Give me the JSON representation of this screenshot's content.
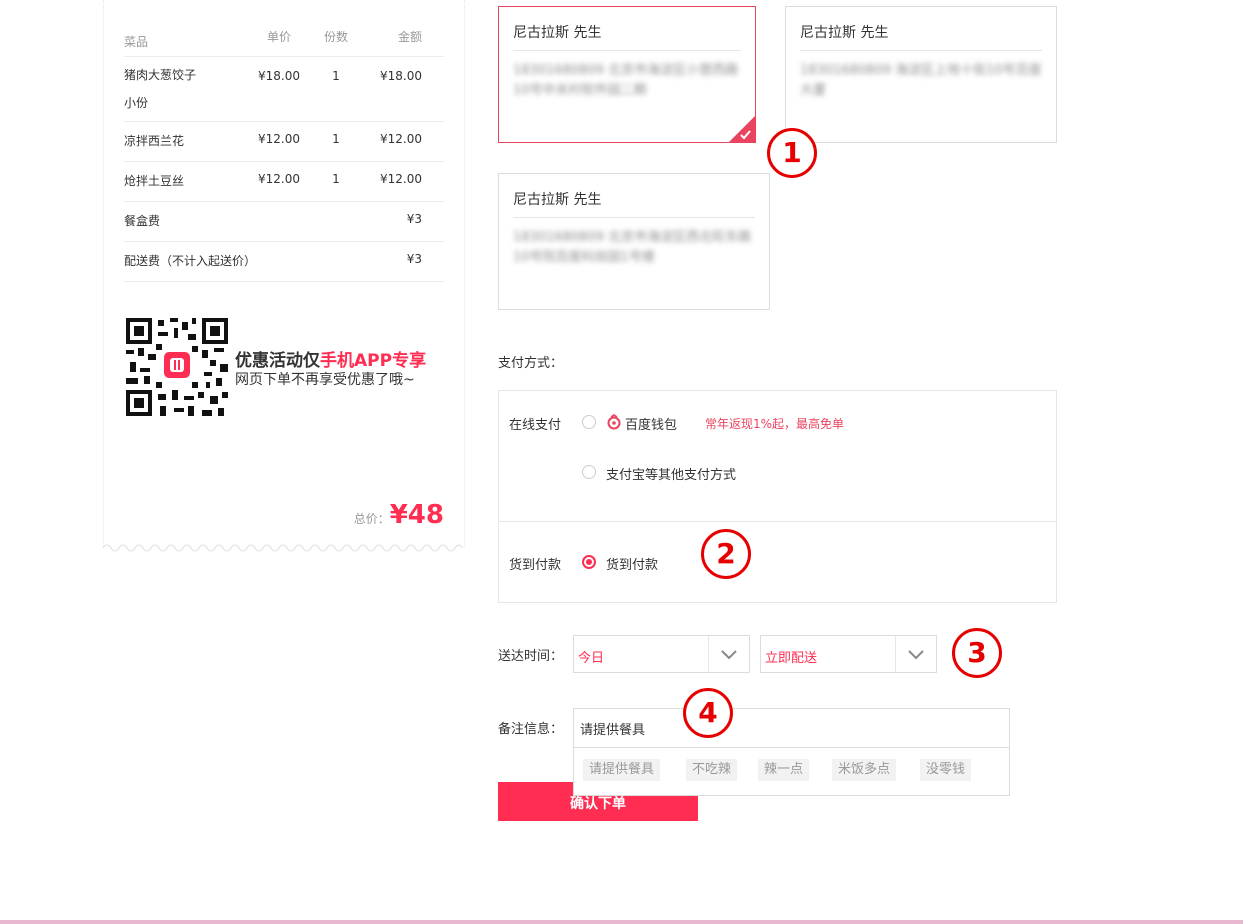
{
  "order": {
    "headers": {
      "name": "菜品",
      "price": "单价",
      "qty": "份数",
      "amount": "金额"
    },
    "items": [
      {
        "name": "猪肉大葱饺子小份",
        "price": "¥18.00",
        "qty": "1",
        "amount": "¥18.00"
      },
      {
        "name": "凉拌西兰花",
        "price": "¥12.00",
        "qty": "1",
        "amount": "¥12.00"
      },
      {
        "name": "炝拌土豆丝",
        "price": "¥12.00",
        "qty": "1",
        "amount": "¥12.00"
      }
    ],
    "fees": [
      {
        "name": "餐盒费",
        "amount": "¥3"
      },
      {
        "name": "配送费（不计入起送价）",
        "amount": "¥3"
      }
    ],
    "promo_line1_prefix": "优惠活动仅",
    "promo_line1_highlight": "手机APP专享",
    "promo_line2": "网页下单不再享受优惠了哦~",
    "total_label": "总价：",
    "total_value": "¥48"
  },
  "addresses": [
    {
      "name": "尼古拉斯 先生",
      "detail": "18301680809 北京市海淀区小营西路10号中关村软件园二期",
      "selected": true
    },
    {
      "name": "尼古拉斯 先生",
      "detail": "18301680809 海淀区上地十街10号百度大厦",
      "selected": false
    },
    {
      "name": "尼古拉斯 先生",
      "detail": "18301680809 北京市海淀区西北旺东路10号院百度科技园1号楼",
      "selected": false
    }
  ],
  "payment": {
    "label": "支付方式：",
    "online_label": "在线支付",
    "baidu_wallet": "百度钱包",
    "baidu_promo": "常年返现1%起，最高免单",
    "other_methods": "支付宝等其他支付方式",
    "cod_label": "货到付款",
    "cod_option": "货到付款"
  },
  "delivery": {
    "label": "送达时间：",
    "day_value": "今日",
    "time_value": "立即配送"
  },
  "remarks": {
    "label": "备注信息：",
    "value": "请提供餐具",
    "tags": [
      "请提供餐具",
      "不吃辣",
      "辣一点",
      "米饭多点",
      "没零钱"
    ]
  },
  "submit_label": "确认下单",
  "annotations": [
    "1",
    "2",
    "3",
    "4"
  ],
  "colors": {
    "accent": "#ff2d52",
    "annotation": "#e60000"
  }
}
